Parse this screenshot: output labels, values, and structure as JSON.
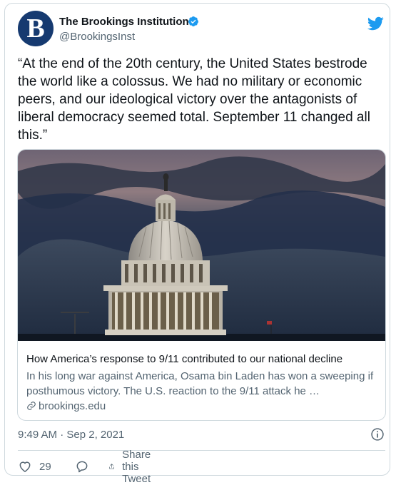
{
  "author": {
    "name": "The Brookings Institution",
    "handle": "@BrookingsInst",
    "avatar_letter": "B",
    "verified": true
  },
  "tweet": {
    "text": "“At the end of the 20th century, the United States bestrode the world like a colossus. We had no military or economic peers, and our ideological victory over the antagonists of liberal democracy seemed total. September 11 changed all this.”"
  },
  "link_card": {
    "title": "How America’s response to 9/11 contributed to our national decline",
    "description": "In his long war against America, Osama bin Laden has won a sweeping if posthumous victory. The U.S. reaction to the 9/11 attack he …",
    "domain": "brookings.edu"
  },
  "meta": {
    "timestamp": "9:49 AM · Sep 2, 2021"
  },
  "actions": {
    "like_count": "29",
    "share_label": "Share this Tweet"
  },
  "colors": {
    "brand_blue": "#1d9bf0",
    "avatar_navy": "#163a70",
    "muted_text": "#536471",
    "border": "#cfd9de"
  },
  "icons": [
    "twitter-bird-icon",
    "verified-badge-icon",
    "link-icon",
    "info-icon",
    "heart-icon",
    "reply-icon",
    "share-icon"
  ]
}
